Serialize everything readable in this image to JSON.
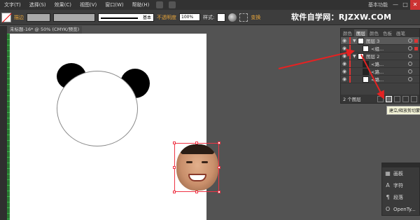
{
  "menu": [
    "文字(T)",
    "选择(S)",
    "效果(C)",
    "视图(V)",
    "窗口(W)",
    "帮助(H)"
  ],
  "workspace": "基本功能",
  "window_controls": [
    "—",
    "□",
    "✕"
  ],
  "control": {
    "stroke_label": "描边",
    "stroke_preset": "基本",
    "opacity_label": "不透明度",
    "opacity_value": "100%",
    "style_label": "样式:",
    "transform_label": "变换"
  },
  "brand": "软件自学网：RJZXW.COM",
  "doc_tab": "未标题-16* @ 50% (CMYK/预览)",
  "layers_panel": {
    "tabs": [
      "颜色",
      "图层",
      "颜色",
      "色板",
      "画笔"
    ],
    "active_tab": 1,
    "rows": [
      {
        "name": "图层 3",
        "expand": "▼"
      },
      {
        "name": "<组...",
        "expand": ""
      },
      {
        "name": "图层 2",
        "expand": "▼"
      },
      {
        "name": "<路...",
        "expand": ""
      },
      {
        "name": "<路...",
        "expand": ""
      },
      {
        "name": "<路...",
        "expand": ""
      }
    ],
    "footer_count": "2 个图层",
    "tooltip": "建立/释放剪切蒙版"
  },
  "right_panel": [
    {
      "icon": "▦",
      "label": "画板",
      "icon_name": "artboard-icon"
    },
    {
      "icon": "A",
      "label": "字符",
      "icon_name": "character-icon"
    },
    {
      "icon": "¶",
      "label": "段落",
      "icon_name": "paragraph-icon"
    },
    {
      "icon": "O",
      "label": "OpenTy...",
      "icon_name": "opentype-icon"
    }
  ],
  "colors": {
    "accent": "#e8a53a",
    "selection": "#ee3344",
    "arrow": "#e52222"
  }
}
